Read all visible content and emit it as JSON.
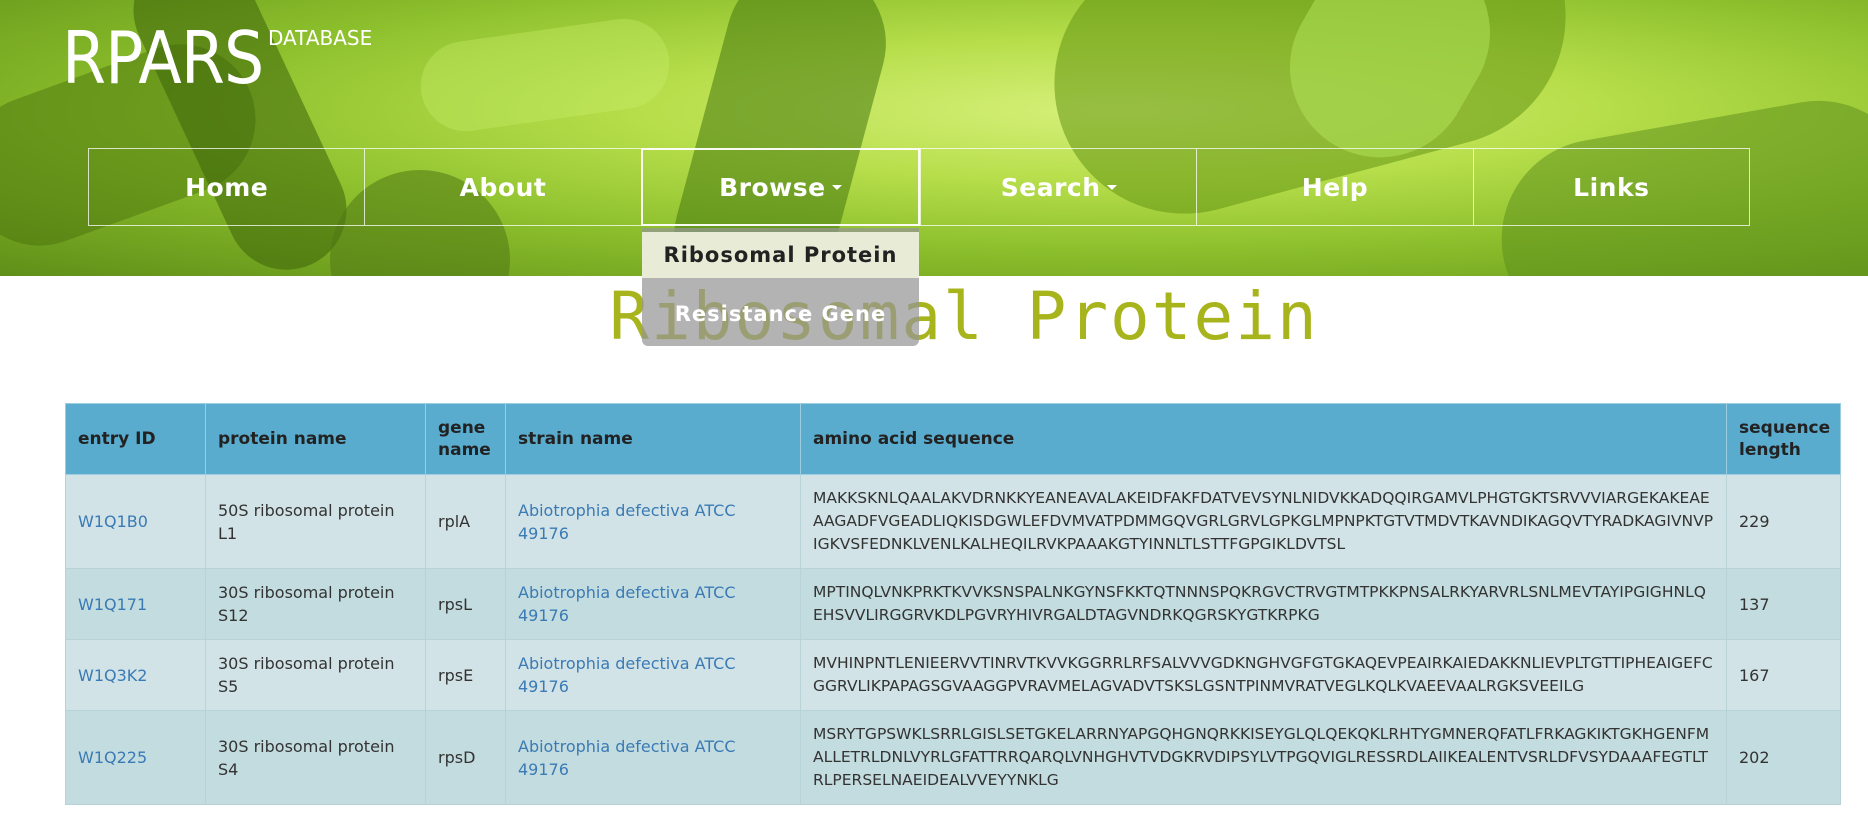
{
  "logo": {
    "main": "RPARS",
    "sub": "DATABASE"
  },
  "nav": [
    {
      "label": "Home",
      "dropdown": false
    },
    {
      "label": "About",
      "dropdown": false
    },
    {
      "label": "Browse",
      "dropdown": true
    },
    {
      "label": "Search",
      "dropdown": true
    },
    {
      "label": "Help",
      "dropdown": false
    },
    {
      "label": "Links",
      "dropdown": false
    }
  ],
  "dropdown": {
    "items": [
      "Ribosomal Protein",
      "Resistance Gene"
    ]
  },
  "page_title": "Ribosomal Protein",
  "table": {
    "headers": [
      "entry ID",
      "protein name",
      "gene name",
      "strain name",
      "amino acid sequence",
      "sequence length"
    ],
    "rows": [
      {
        "id": "W1Q1B0",
        "protein": "50S ribosomal protein L1",
        "gene": "rplA",
        "strain": "Abiotrophia defectiva ATCC 49176",
        "seq": "MAKKSKNLQAALAKVDRNKKYEANEAVALAKEIDFAKFDATVEVSYNLNIDVKKADQQIRGAMVLPHGTGKTSRVVVIARGEKAKEAEAAGADFVGEADLIQKISDGWLEFDVMVATPDMMGQVGRLGRVLGPKGLMPNPKTGTVTMDVTKAVNDIKAGQVTYRADKAGIVNVPIGKVSFEDNKLVENLKALHEQILRVKPAAAKGTYINNLTLSTTFGPGIKLDVTSL",
        "len": "229"
      },
      {
        "id": "W1Q171",
        "protein": "30S ribosomal protein S12",
        "gene": "rpsL",
        "strain": "Abiotrophia defectiva ATCC 49176",
        "seq": "MPTINQLVNKPRKTKVVKSNSPALNKGYNSFKKTQTNNNSPQKRGVCTRVGTMTPKKPNSALRKYARVRLSNLMEVTAYIPGIGHNLQEHSVVLIRGGRVKDLPGVRYHIVRGALDTAGVNDRKQGRSKYGTKRPKG",
        "len": "137"
      },
      {
        "id": "W1Q3K2",
        "protein": "30S ribosomal protein S5",
        "gene": "rpsE",
        "strain": "Abiotrophia defectiva ATCC 49176",
        "seq": "MVHINPNTLENIEERVVTINRVTKVVKGGRRLRFSALVVVGDKNGHVGFGTGKAQEVPEAIRKAIEDAKKNLIEVPLTGTTIPHEAIGEFCGGRVLIKPAPAGSGVAAGGPVRAVMELAGVADVTSKSLGSNTPINMVRATVEGLKQLKVAEEVAALRGKSVEEILG",
        "len": "167"
      },
      {
        "id": "W1Q225",
        "protein": "30S ribosomal protein S4",
        "gene": "rpsD",
        "strain": "Abiotrophia defectiva ATCC 49176",
        "seq": "MSRYTGPSWKLSRRLGISLSETGKELARRNYAPGQHGNQRKKISEYGLQLQEKQKLRHTYGMNERQFATLFRKAGKIKTGKHGENFMALLETRLDNLVYRLGFATTRRQARQLVNHGHVTVDGKRVDIPSYLVTPGQVIGLRESSRDLAIIKEALENTVSRLDFVSYDAAAFEGTLTRLPERSELNAEIDEALVVEYYNKLG",
        "len": "202"
      }
    ]
  }
}
